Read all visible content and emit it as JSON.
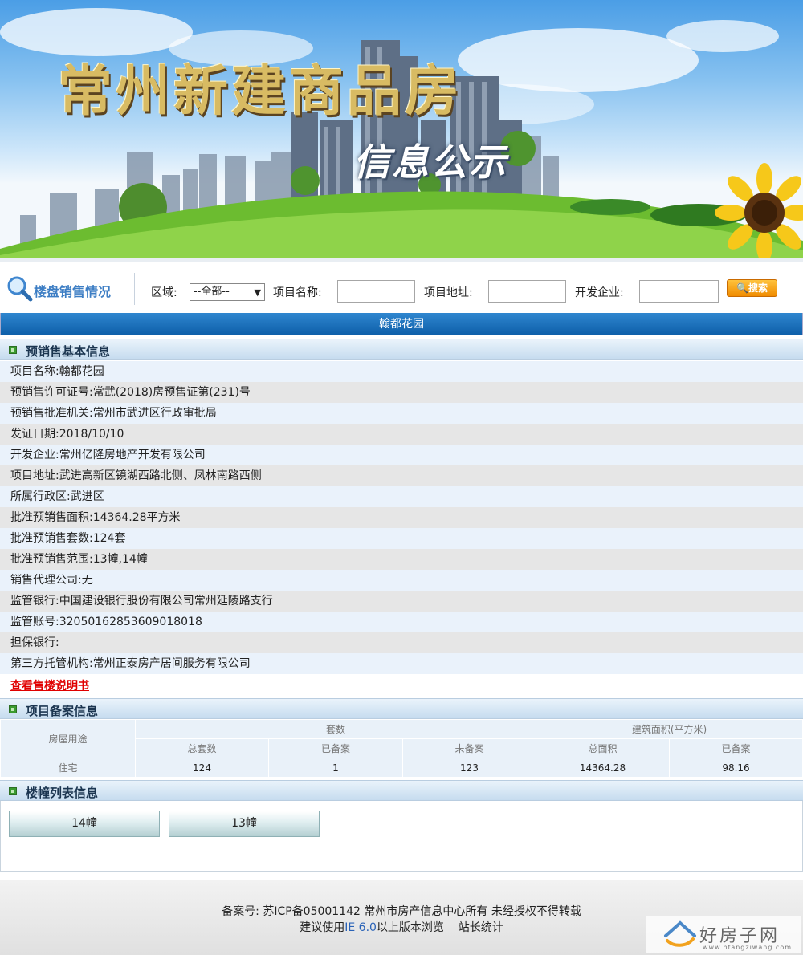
{
  "banner": {
    "title": "常州新建商品房",
    "subtitle": "信息公示"
  },
  "search": {
    "section_title": "楼盘销售情况",
    "region_label": "区域:",
    "region_selected": "--全部--",
    "project_name_label": "项目名称:",
    "project_address_label": "项目地址:",
    "developer_label": "开发企业:",
    "search_button": "搜索"
  },
  "project": {
    "name": "翰都花园"
  },
  "presale": {
    "heading": "预销售基本信息",
    "rows": [
      {
        "label": "项目名称:",
        "value": "翰都花园"
      },
      {
        "label": "预销售许可证号:",
        "value": "常武(2018)房预售证第(231)号"
      },
      {
        "label": "预销售批准机关:",
        "value": "常州市武进区行政审批局"
      },
      {
        "label": "发证日期:",
        "value": "2018/10/10"
      },
      {
        "label": "开发企业:",
        "value": "常州亿隆房地产开发有限公司"
      },
      {
        "label": "项目地址:",
        "value": "武进高新区镜湖西路北侧、凤林南路西侧"
      },
      {
        "label": "所属行政区:",
        "value": "武进区"
      },
      {
        "label": "批准预销售面积:",
        "value": "14364.28平方米"
      },
      {
        "label": "批准预销售套数:",
        "value": "124套"
      },
      {
        "label": "批准预销售范围:",
        "value": "13幢,14幢"
      },
      {
        "label": "销售代理公司:",
        "value": "无"
      },
      {
        "label": "监管银行:",
        "value": "中国建设银行股份有限公司常州延陵路支行"
      },
      {
        "label": "监管账号:",
        "value": "32050162853609018018"
      },
      {
        "label": "担保银行:",
        "value": ""
      },
      {
        "label": "第三方托管机构:",
        "value": "常州正泰房产居间服务有限公司"
      }
    ],
    "manual_link": "查看售楼说明书"
  },
  "record": {
    "heading": "项目备案信息",
    "col_usage": "房屋用途",
    "col_units": "套数",
    "col_area": "建筑面积(平方米)",
    "sub_total_units": "总套数",
    "sub_filed": "已备案",
    "sub_unfiled": "未备案",
    "sub_total_area": "总面积",
    "sub_area_filed": "已备案",
    "row": {
      "usage": "住宅",
      "total_units": "124",
      "filed": "1",
      "unfiled": "123",
      "total_area": "14364.28",
      "area_filed": "98.16"
    }
  },
  "buildings": {
    "heading": "楼幢列表信息",
    "items": [
      "14幢",
      "13幢"
    ]
  },
  "footer": {
    "line1": "备案号: 苏ICP备05001142 常州市房产信息中心所有 未经授权不得转载",
    "line2_prefix": "建议使用",
    "line2_ie": "IE 6.0",
    "line2_suffix": "以上版本浏览",
    "stats_link": "站长统计"
  },
  "watermark": {
    "text": "好房子网",
    "url": "www.hfangziwang.com"
  }
}
